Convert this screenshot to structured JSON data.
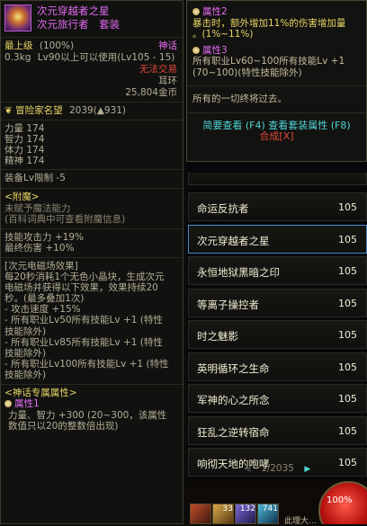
{
  "tooltip": {
    "name": "次元穿越者之星",
    "set": "次元旅行者　套装",
    "grade": "最上级",
    "grade_pct": "(100%)",
    "rarity": "神话",
    "weight": "0.3kg",
    "level_req": "Lv90以上可以使用(Lv105 - 15)",
    "trade": "无法交易",
    "slot": "耳环",
    "price": "25,804金币",
    "adventurer_rep_label": "冒险家名望",
    "adventurer_rep_value": "2039(▲931)",
    "stats": [
      {
        "name": "力量",
        "value": "174"
      },
      {
        "name": "智力",
        "value": "174"
      },
      {
        "name": "体力",
        "value": "174"
      },
      {
        "name": "精神",
        "value": "174"
      }
    ],
    "equip_lv_limit": "装备Lv限制 -5",
    "enchant_title": "<附魔>",
    "enchant_none": "未赋予魔法能力",
    "enchant_hint": "(百科词典中可查看附魔信息)",
    "skill_attack": "技能攻击力 +19%",
    "final_damage": "最终伤害 +10%",
    "ability_lines": [
      "[次元电磁场效果]",
      "每20秒消耗1个无色小晶块，生成次元",
      "电磁场并获得以下效果，效果持续20",
      "秒。(最多叠加1次)",
      "- 攻击速度 +15%",
      "- 所有职业Lv50所有技能Lv +1 (特性",
      "技能除外)",
      "- 所有职业Lv85所有技能Lv +1 (特性",
      "技能除外)",
      "- 所有职业Lv100所有技能Lv +1 (特性",
      "技能除外)"
    ],
    "myth_title": "<神话专属属性>",
    "attr1_label": "属性1",
    "attr1_lines": [
      "力量、智力 +300 (20~300，该属性",
      "数值只以20的整数倍出现)"
    ]
  },
  "popup": {
    "attr2_label": "属性2",
    "attr2_lines": [
      "暴击时，额外增加11%的伤害增加量",
      "。(1%~11%)"
    ],
    "attr3_label": "属性3",
    "attr3_lines": [
      "所有职业Lv60~100所有技能Lv +1",
      "(70~100)(特性技能除外)"
    ],
    "quote": "所有的一切终将过去。",
    "buttons": "简要查看 (F4) 查看套装属性 (F8)",
    "combine": "合成[X]"
  },
  "list": {
    "items": [
      {
        "name": "",
        "level": ""
      },
      {
        "name": "命运反抗者",
        "level": "105"
      },
      {
        "name": "次元穿越者之星",
        "level": "105",
        "selected": true
      },
      {
        "name": "永恒地狱黑暗之印",
        "level": "105"
      },
      {
        "name": "等离子操控者",
        "level": "105"
      },
      {
        "name": "时之魅影",
        "level": "105"
      },
      {
        "name": "英明循环之生命",
        "level": "105"
      },
      {
        "name": "军神的心之所念",
        "level": "105"
      },
      {
        "name": "狂乱之逆转宿命",
        "level": "105"
      },
      {
        "name": "响彻天地的咆哮",
        "level": "105"
      }
    ],
    "page": "1/2035"
  },
  "hud": {
    "hp_pct": "100%",
    "skill_nums": [
      "33",
      "132",
      "741"
    ],
    "bottom_text": "此理大..."
  }
}
